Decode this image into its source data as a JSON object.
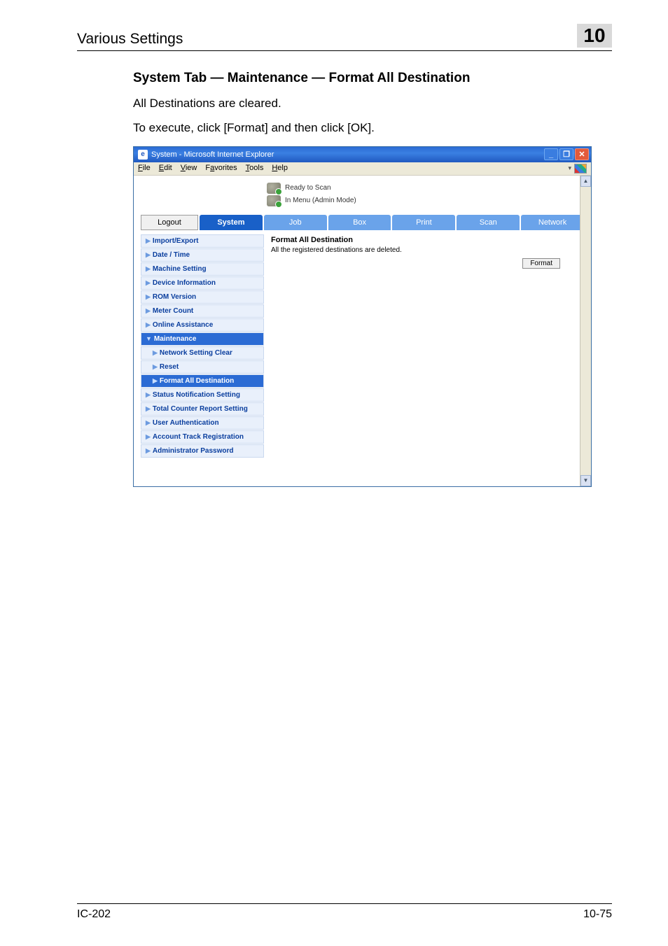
{
  "chapter": {
    "title": "Various Settings",
    "number": "10"
  },
  "heading": "System Tab — Maintenance — Format All Destination",
  "para1": "All Destinations are cleared.",
  "para2": "To execute, click [Format] and then click [OK].",
  "browser": {
    "title": "System - Microsoft Internet Explorer",
    "menus": {
      "file": "File",
      "edit": "Edit",
      "view": "View",
      "favorites": "Favorites",
      "tools": "Tools",
      "help": "Help"
    }
  },
  "status": {
    "line1": "Ready to Scan",
    "line2": "In Menu (Admin Mode)"
  },
  "tabs": {
    "logout": "Logout",
    "system": "System",
    "job": "Job",
    "box": "Box",
    "print": "Print",
    "scan": "Scan",
    "network": "Network"
  },
  "nav": {
    "import_export": "Import/Export",
    "date_time": "Date / Time",
    "machine_setting": "Machine Setting",
    "device_info": "Device Information",
    "rom_version": "ROM Version",
    "meter_count": "Meter Count",
    "online_assist": "Online Assistance",
    "maintenance": "Maintenance",
    "network_clear": "Network Setting Clear",
    "reset": "Reset",
    "format_all": "Format All Destination",
    "status_notif": "Status Notification Setting",
    "total_counter": "Total Counter Report Setting",
    "user_auth": "User Authentication",
    "account_track": "Account Track Registration",
    "admin_pwd": "Administrator Password"
  },
  "panel": {
    "title": "Format All Destination",
    "desc": "All the registered destinations are deleted.",
    "format_btn": "Format"
  },
  "footer": {
    "left": "IC-202",
    "right": "10-75"
  }
}
